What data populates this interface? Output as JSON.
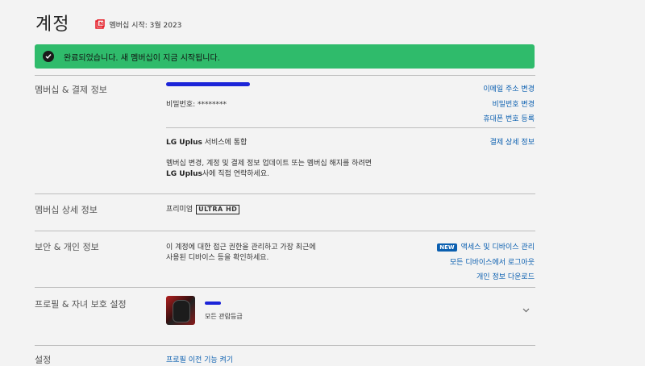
{
  "header": {
    "title": "계정",
    "member_since": "멤버십 시작: 3월 2023"
  },
  "banner": {
    "message": "완료되었습니다. 새 멤버십이 지금 시작됩니다."
  },
  "membership": {
    "label": "멤버십 & 결제 정보",
    "password": "비밀번호: ********",
    "links": [
      "이메일 주소 변경",
      "비밀번호 변경",
      "휴대폰 번호 등록"
    ],
    "partner_name": "LG Uplus",
    "partner_suffix": " 서비스에 통합",
    "billing_link": "결제 상세 정보",
    "billing_note_1": "멤버십 변경, 계정 및 결제 정보 업데이트 또는 멤버십 해지를 하려면",
    "billing_note_2_name": "LG Uplus",
    "billing_note_2_rest": "사에 직접 연락하세요."
  },
  "plan": {
    "label": "멤버십 상세 정보",
    "name": "프리미엄",
    "badge": "ULTRA HD"
  },
  "security": {
    "label": "보안 & 개인 정보",
    "desc_1": "이 계정에 대한 접근 권한을 관리하고 가장 최근에",
    "desc_2": "사용된 디바이스 등을 확인하세요.",
    "new_badge": "NEW",
    "links": [
      "액세스 및 디바이스 관리",
      "모든 디바이스에서 로그아웃",
      "개인 정보 다운로드"
    ]
  },
  "profiles": {
    "label": "프로필 & 자녀 보호 설정",
    "rating": "모든 관람등급"
  },
  "settings": {
    "label": "설정",
    "link": "프로필 이전 기능 켜기"
  },
  "colors": {
    "banner": "#2fbb6b",
    "link": "#0b5fb0",
    "background": "#f3f3f3"
  }
}
